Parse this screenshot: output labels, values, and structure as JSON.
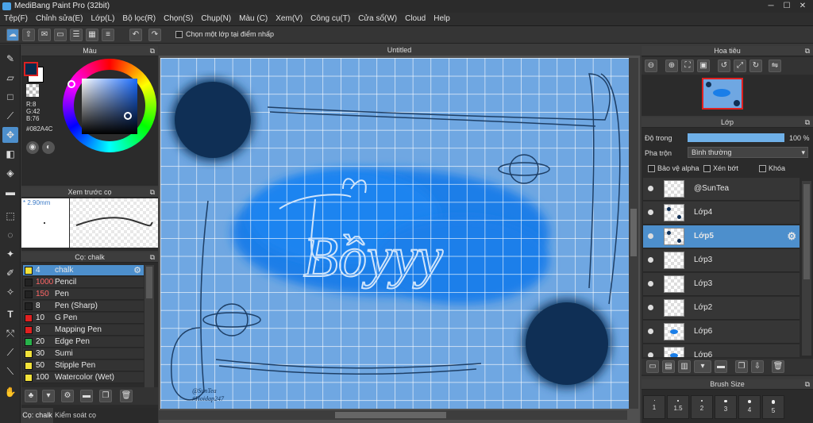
{
  "app": {
    "title": "MediBang Paint Pro (32bit)"
  },
  "menu": [
    "Tệp(F)",
    "Chỉnh sửa(E)",
    "Lớp(L)",
    "Bộ lọc(R)",
    "Chọn(S)",
    "Chụp(N)",
    "Màu (C)",
    "Xem(V)",
    "Công cụ(T)",
    "Cửa sổ(W)",
    "Cloud",
    "Help"
  ],
  "toolbar": {
    "checkbox_label": "Chọn một lớp tại điểm nhấp"
  },
  "color_panel": {
    "title": "Màu",
    "r": "R:8",
    "g": "G:42",
    "b": "B:76",
    "hex": "#082A4C",
    "fg": "#082A4C"
  },
  "preview_panel": {
    "title": "Xem trước cọ",
    "size": "2.90mm"
  },
  "brush_panel": {
    "title": "Cọ: chalk",
    "items": [
      {
        "size": "4",
        "name": "chalk",
        "color": "#f2e23a"
      },
      {
        "size": "1000",
        "name": "Pencil",
        "color": "#222222"
      },
      {
        "size": "150",
        "name": "Pen",
        "color": "#222222"
      },
      {
        "size": "8",
        "name": "Pen (Sharp)",
        "color": "#222222"
      },
      {
        "size": "10",
        "name": "G Pen",
        "color": "#e02020"
      },
      {
        "size": "8",
        "name": "Mapping Pen",
        "color": "#e02020"
      },
      {
        "size": "20",
        "name": "Edge Pen",
        "color": "#27b24a"
      },
      {
        "size": "30",
        "name": "Sumi",
        "color": "#f2e23a"
      },
      {
        "size": "50",
        "name": "Stipple Pen",
        "color": "#f2e23a"
      },
      {
        "size": "100",
        "name": "Watercolor (Wet)",
        "color": "#f2e23a"
      }
    ],
    "tab1": "Cọ: chalk",
    "tab2": "Kiểm soát cọ"
  },
  "canvas": {
    "tab": "Untitled",
    "watermark1": "@SunTea",
    "watermark2": "#Hoidap247",
    "main_text": "Bồyyy"
  },
  "navigator": {
    "title": "Hoa tiêu"
  },
  "layer_panel": {
    "title": "Lớp",
    "opacity_label": "Độ trong",
    "opacity_value": "100 %",
    "opacity": 1.0,
    "blend_label": "Pha trộn",
    "blend_value": "Bình thường",
    "protect_alpha": "Bảo vệ alpha",
    "clipping": "Xén bớt",
    "lock": "Khóa",
    "layers": [
      {
        "name": "@SunTea"
      },
      {
        "name": "Lớp4"
      },
      {
        "name": "Lớp5"
      },
      {
        "name": "Lớp3"
      },
      {
        "name": "Lớp3"
      },
      {
        "name": "Lớp2"
      },
      {
        "name": "Lớp6"
      },
      {
        "name": "Lớp6"
      }
    ]
  },
  "brush_size": {
    "title": "Brush Size",
    "sizes": [
      "1",
      "1.5",
      "2",
      "3",
      "4",
      "5"
    ]
  }
}
